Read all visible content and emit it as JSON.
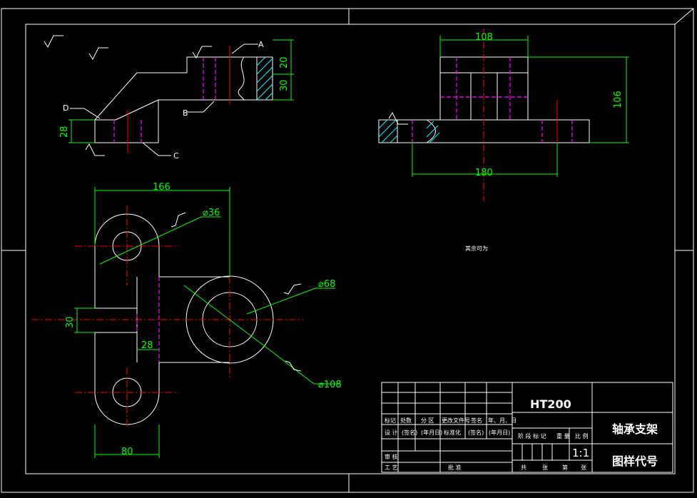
{
  "drawing": {
    "title": "轴承支架",
    "drawing_code_label": "图样代号",
    "material": "HT200",
    "scale": "1:1",
    "note": "其余可为",
    "dimensions": {
      "top_width": "108",
      "base_width": "180",
      "total_height": "106",
      "plan_length": "166",
      "hole_small": "⌀36",
      "boss_inner": "⌀68",
      "boss_outer": "⌀108",
      "height_20": "20",
      "height_30": "30",
      "depth_28": "28",
      "width_30": "30",
      "rib_28": "28",
      "width_80": "80"
    },
    "callouts": [
      "A",
      "B",
      "C",
      "D"
    ],
    "title_block": {
      "row_a": [
        "标记",
        "处数",
        "分 区",
        "更改文件号",
        "签名",
        "年、月、日"
      ],
      "row_b": [
        "设 计",
        "(签名)",
        "(年月日)",
        "标准化",
        "(签名)",
        "(年月日)"
      ],
      "row_c": [
        "审 核"
      ],
      "row_d": [
        "工 艺",
        "批 准"
      ],
      "stage_row": [
        "阶 段 标 记",
        "重 量",
        "比 例"
      ],
      "sheet_row": [
        "共",
        "张",
        "第",
        "张"
      ]
    }
  }
}
